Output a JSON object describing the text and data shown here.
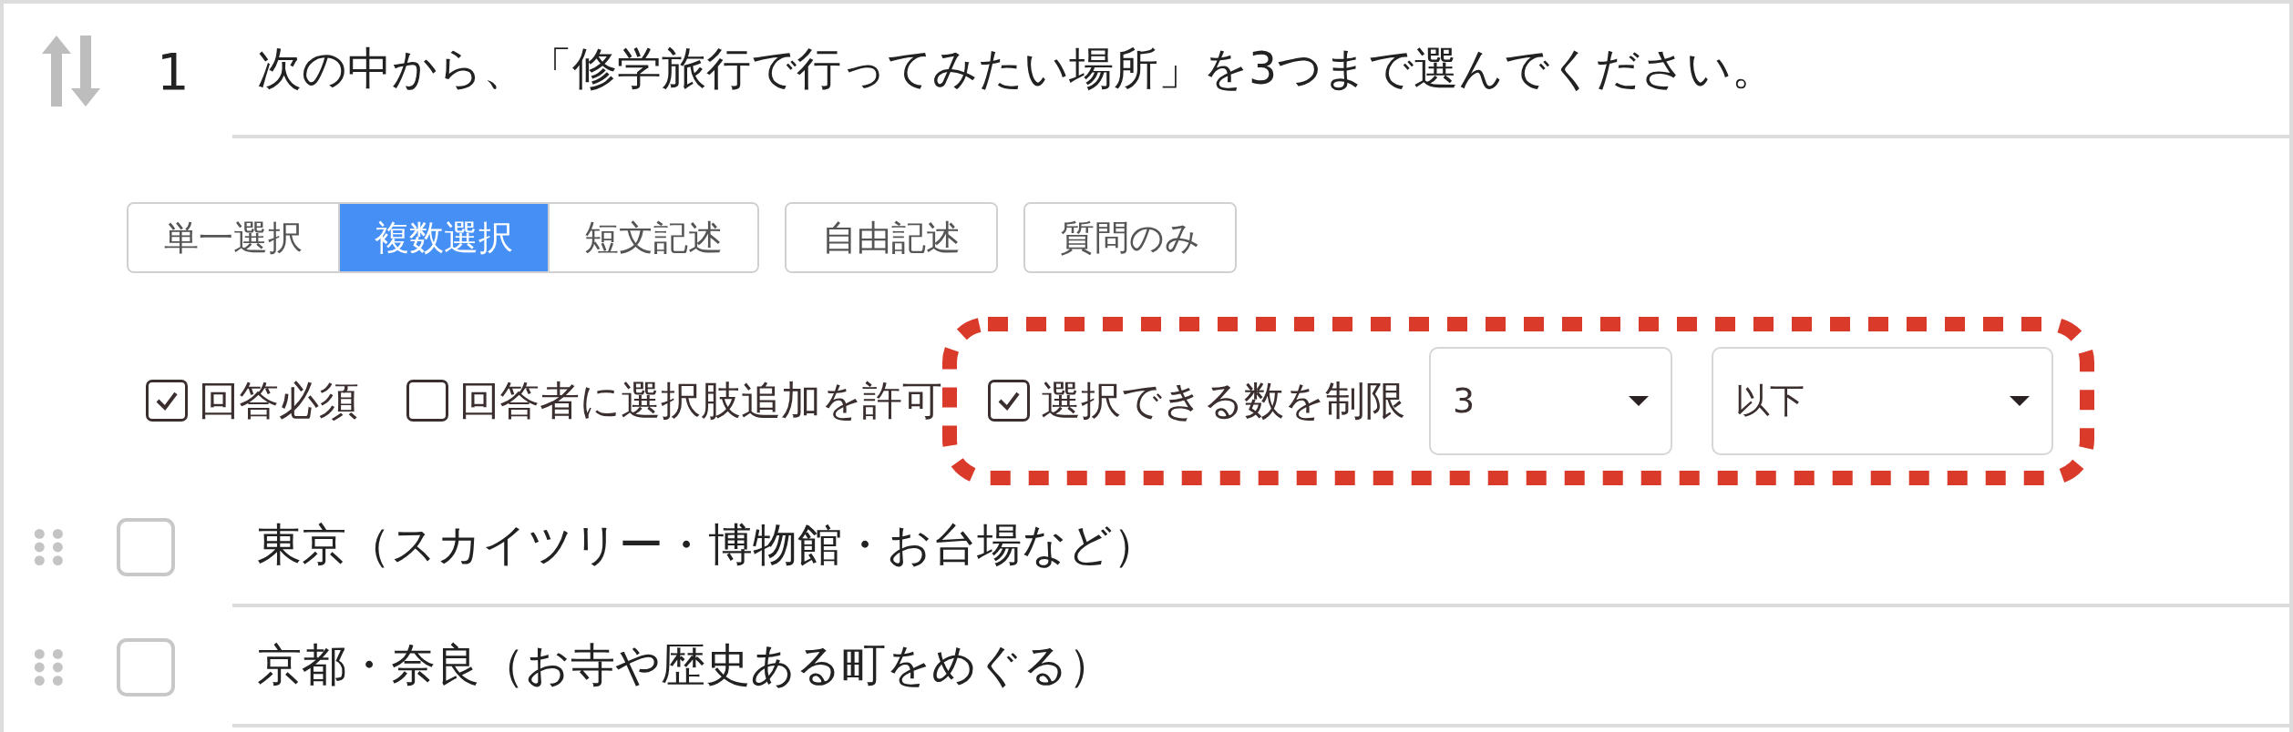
{
  "question": {
    "number": "1",
    "text": "次の中から、「修学旅行で行ってみたい場所」を3つまで選んでください。"
  },
  "answer_type_groups": [
    {
      "buttons": [
        {
          "label": "単一選択",
          "selected": false
        },
        {
          "label": "複数選択",
          "selected": true
        },
        {
          "label": "短文記述",
          "selected": false
        }
      ]
    },
    {
      "buttons": [
        {
          "label": "自由記述",
          "selected": false
        }
      ]
    },
    {
      "buttons": [
        {
          "label": "質問のみ",
          "selected": false
        }
      ]
    }
  ],
  "settings": [
    {
      "label": "回答必須",
      "checked": true
    },
    {
      "label": "回答者に選択肢追加を許可",
      "checked": false
    }
  ],
  "limit": {
    "label": "選択できる数を制限",
    "checked": true,
    "count": "3",
    "condition": "以下",
    "highlighted": true
  },
  "choices": [
    {
      "text": "東京（スカイツリー・博物館・お台場など）",
      "checked": false
    },
    {
      "text": "京都・奈良（お寺や歴史ある町をめぐる）",
      "checked": false
    }
  ]
}
